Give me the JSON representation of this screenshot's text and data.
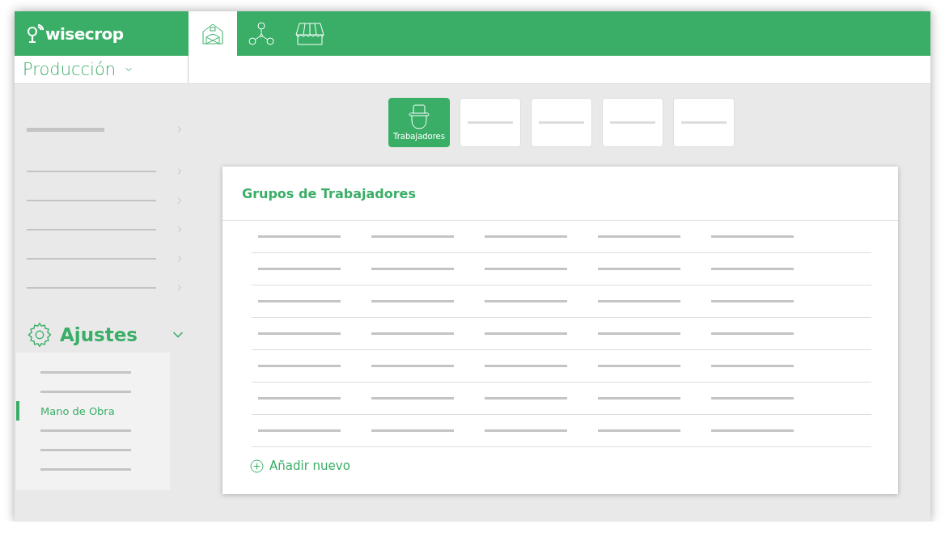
{
  "header": {
    "logo": "wisecrop",
    "tabs": [
      {
        "kind": "barn",
        "selected": true
      },
      {
        "kind": "network",
        "selected": false
      },
      {
        "kind": "market",
        "selected": false
      }
    ]
  },
  "section": {
    "label": "Producción"
  },
  "settings": {
    "label": "Ajustes",
    "expanded": true,
    "items": [
      {
        "selected": false
      },
      {
        "selected": false
      },
      {
        "label": "Mano de Obra",
        "selected": true
      },
      {
        "selected": false
      },
      {
        "selected": false
      },
      {
        "selected": false
      }
    ]
  },
  "steps": [
    {
      "label": "Trabajadores",
      "selected": true
    },
    {
      "selected": false
    },
    {
      "selected": false
    },
    {
      "selected": false
    },
    {
      "selected": false
    }
  ],
  "card": {
    "title": "Grupos de Trabajadores",
    "add_label": "Añadir nuevo"
  }
}
